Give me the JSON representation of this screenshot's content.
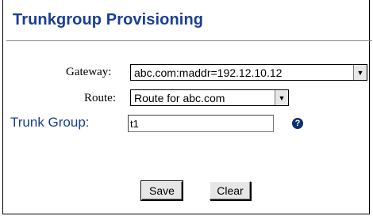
{
  "title": "Trunkgroup Provisioning",
  "form": {
    "gateway": {
      "label": "Gateway:",
      "value": "abc.com:maddr=192.12.10.12"
    },
    "route": {
      "label": "Route:",
      "value": "Route for abc.com"
    },
    "trunk_group": {
      "label": "Trunk Group:",
      "value": "t1"
    }
  },
  "buttons": {
    "save": "Save",
    "clear": "Clear"
  },
  "icons": {
    "help": "help-icon",
    "dropdown": "chevron-down-icon"
  },
  "colors": {
    "title": "#1a3e95",
    "label_accent": "#1a3e95",
    "help_icon": "#0b2f70"
  }
}
